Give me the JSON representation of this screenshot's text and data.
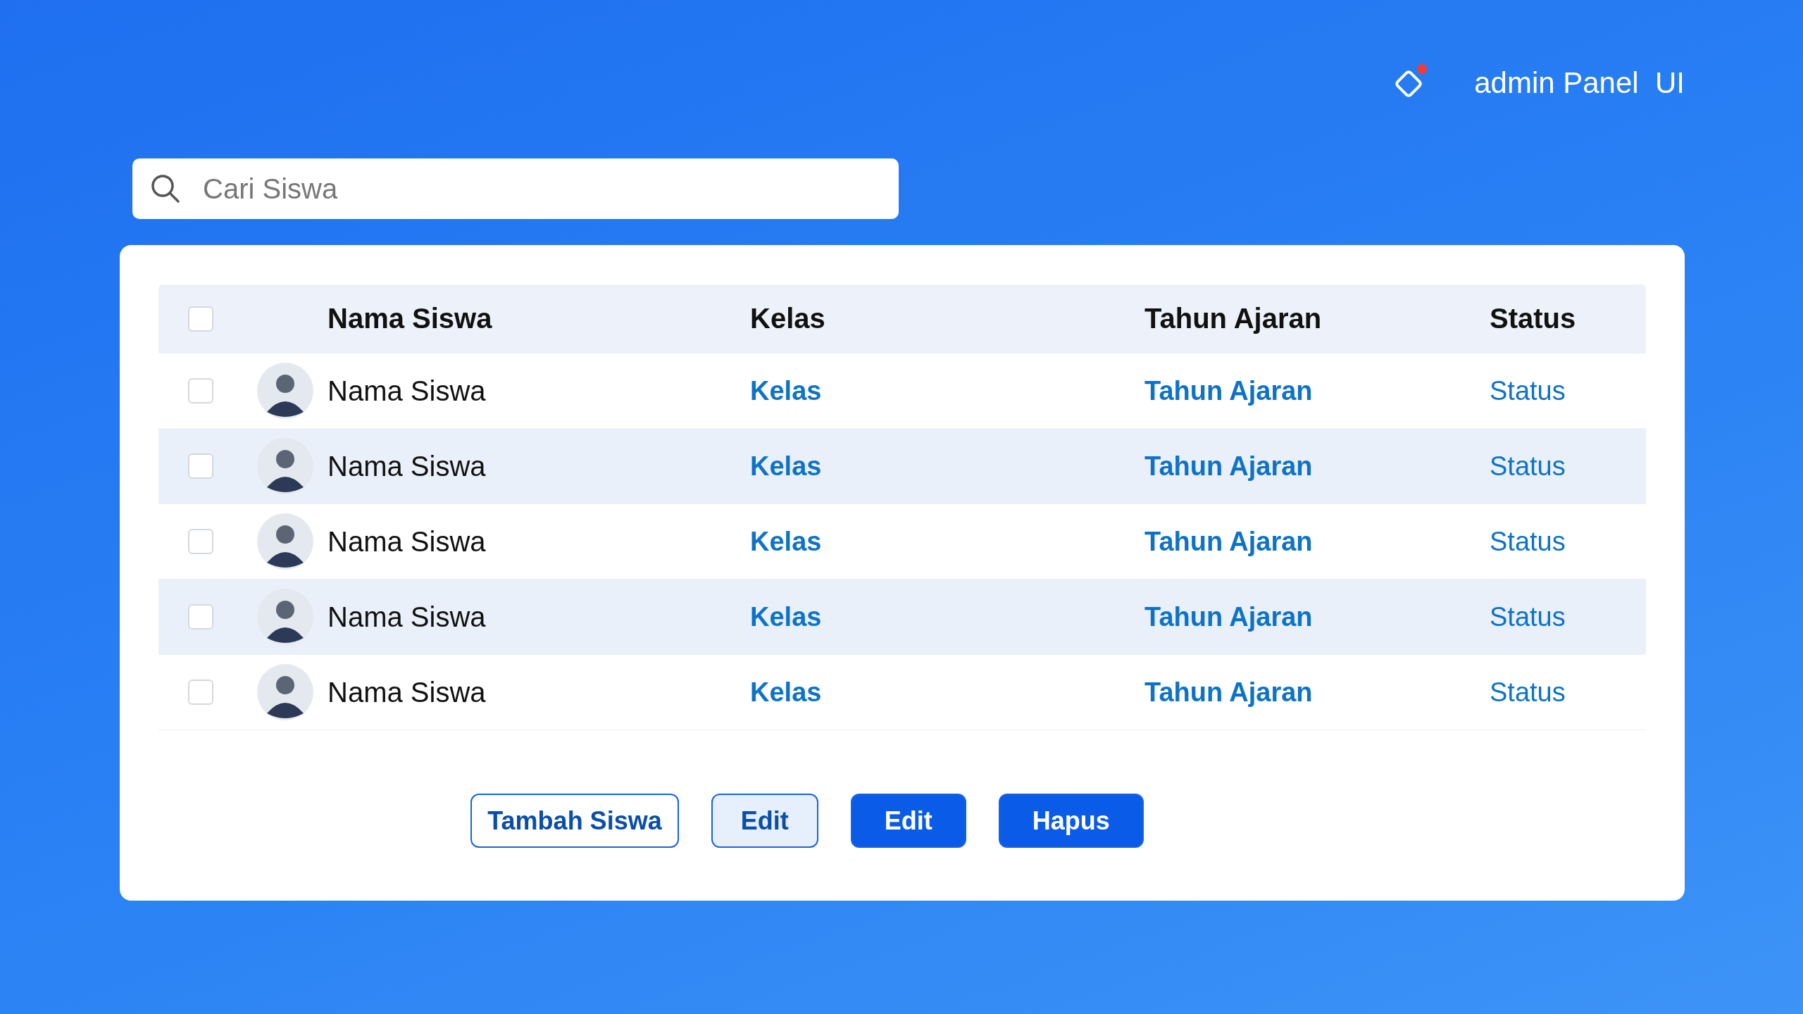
{
  "header": {
    "title": "admin Panel  UI",
    "notification": true
  },
  "search": {
    "placeholder": "Cari Siswa"
  },
  "table": {
    "select_all": {
      "checked": false
    },
    "columns": [
      "Nama Siswa",
      "Kelas",
      "Tahun Ajaran",
      "Status"
    ],
    "rows": [
      {
        "checked": false,
        "name": "Nama Siswa",
        "kelas": "Kelas",
        "tahun": "Tahun Ajaran",
        "status": "Status"
      },
      {
        "checked": false,
        "name": "Nama Siswa",
        "kelas": "Kelas",
        "tahun": "Tahun Ajaran",
        "status": "Status"
      },
      {
        "checked": false,
        "name": "Nama Siswa",
        "kelas": "Kelas",
        "tahun": "Tahun Ajaran",
        "status": "Status"
      },
      {
        "checked": false,
        "name": "Nama Siswa",
        "kelas": "Kelas",
        "tahun": "Tahun Ajaran",
        "status": "Status"
      },
      {
        "checked": false,
        "name": "Nama Siswa",
        "kelas": "Kelas",
        "tahun": "Tahun Ajaran",
        "status": "Status"
      }
    ]
  },
  "buttons": [
    {
      "label": "Tambah Siswa",
      "kind": "outline"
    },
    {
      "label": "Edit",
      "kind": "soft"
    },
    {
      "label": "Edit",
      "kind": "filled"
    },
    {
      "label": "Hapus",
      "kind": "filled"
    }
  ]
}
